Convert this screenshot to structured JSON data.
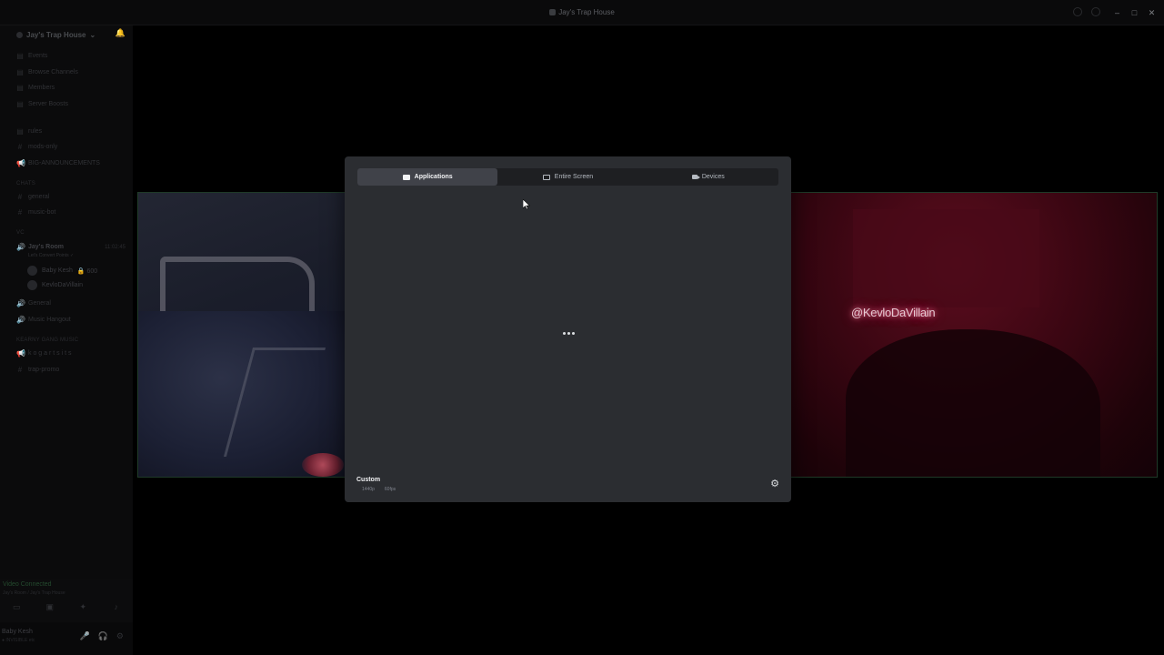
{
  "window": {
    "title": "Jay's Trap House",
    "controls": [
      "–",
      "□",
      "✕"
    ]
  },
  "sidebar": {
    "server_name": "Jay's Trap House",
    "items": [
      {
        "label": "Events",
        "icon": "calendar-icon"
      },
      {
        "label": "Browse Channels",
        "icon": "browse-icon"
      },
      {
        "label": "Members",
        "icon": "members-icon"
      },
      {
        "label": "Server Boosts",
        "icon": "boost-icon"
      },
      {
        "label": "rules",
        "icon": "rules-icon"
      },
      {
        "label": "mods-only",
        "icon": "hash-icon"
      },
      {
        "label": "BIG-ANNOUNCEMENTS",
        "icon": "announcement-icon"
      }
    ],
    "categories": {
      "text": "Chats",
      "voice": "VC",
      "bottom": "KEARNY GANG MUSIC"
    },
    "text_channels": [
      "general",
      "music-bot"
    ],
    "voice_room": {
      "label": "Jay's Room",
      "time": "11:02:45",
      "subtitle": "Let's Convert Points ✓"
    },
    "voice_members": [
      {
        "name": "Baby Kesh",
        "tag": "🔒 600"
      },
      {
        "name": "KevloDaVillain",
        "tag": ""
      }
    ],
    "other_voice": [
      "General",
      "Music Hangout"
    ],
    "bottom_items": [
      "k o g a r t s i t s",
      "trap-promo"
    ],
    "voice_connected": {
      "status": "Video Connected",
      "sub": "Jay's Room / Jay's Trap House"
    },
    "user": {
      "name": "Baby Kesh",
      "status": "● INVISIBLE etc"
    }
  },
  "stream": {
    "overlay_text": "@KevloDaVillain"
  },
  "modal": {
    "tabs": [
      {
        "label": "Applications",
        "active": true
      },
      {
        "label": "Entire Screen",
        "active": false
      },
      {
        "label": "Devices",
        "active": false
      }
    ],
    "quality": {
      "title": "Custom",
      "resolution": "1440p",
      "fps": "60fps"
    }
  },
  "colors": {
    "accent_green": "#23a55a",
    "modal_bg": "#2b2d31",
    "tab_active": "#404249"
  }
}
